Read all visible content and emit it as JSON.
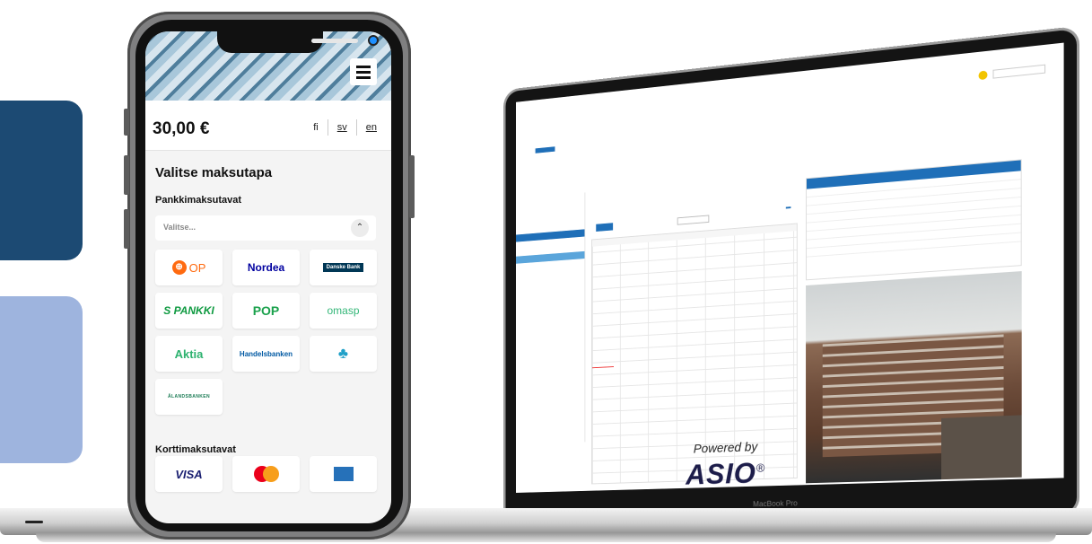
{
  "phone": {
    "price": "30,00 €",
    "languages": [
      {
        "code": "fi",
        "active": false
      },
      {
        "code": "sv",
        "active": true
      },
      {
        "code": "en",
        "active": true
      }
    ],
    "heading": "Valitse maksutapa",
    "bank_section_label": "Pankkimaksutavat",
    "bank_select_placeholder": "Valitse...",
    "banks": [
      "OP",
      "Nordea",
      "Danske Bank",
      "S PANKKI",
      "POP",
      "omasp",
      "Aktia",
      "Handelsbanken",
      "Säästöpankki",
      "ÅLANDSBANKEN"
    ],
    "card_section_label": "Korttimaksutavat",
    "cards": [
      "VISA",
      "Mastercard",
      "American Express"
    ]
  },
  "laptop": {
    "powered_line1": "Powered by",
    "powered_line2": "ASIO",
    "powered_mark": "®",
    "bezel_label": "MacBook Pro"
  },
  "icons": {
    "menu": "hamburger-icon",
    "chevron": "chevron-up-icon",
    "camera": "camera-dot",
    "op_logo": "op-logo",
    "spb_logo": "savings-bank-tree-icon"
  },
  "colors": {
    "deco_dark": "#1c4a73",
    "deco_light": "#9eb4de",
    "asio_blue": "#1f6fb8",
    "op_orange": "#ff6a10"
  }
}
